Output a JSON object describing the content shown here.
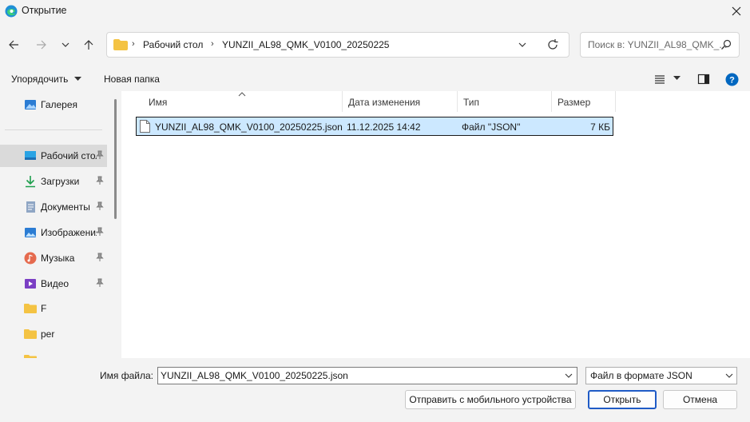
{
  "window": {
    "title": "Открытие",
    "close_glyph": "✕"
  },
  "address": {
    "segments": [
      "Рабочий стол",
      "YUNZII_AL98_QMK_V0100_20250225"
    ],
    "separator": "›"
  },
  "search": {
    "placeholder": "Поиск в: YUNZII_AL98_QMK_..."
  },
  "toolbar": {
    "organize_label": "Упорядочить",
    "new_folder_label": "Новая папка"
  },
  "sidebar": {
    "items": [
      {
        "label": "Галерея",
        "icon": "gallery-icon",
        "pinned": false
      },
      {
        "label": "Рабочий стол",
        "icon": "desktop-icon",
        "pinned": true,
        "selected": true
      },
      {
        "label": "Загрузки",
        "icon": "download-icon",
        "pinned": true
      },
      {
        "label": "Документы",
        "icon": "documents-icon",
        "pinned": true
      },
      {
        "label": "Изображения",
        "icon": "pictures-icon",
        "pinned": true
      },
      {
        "label": "Музыка",
        "icon": "music-icon",
        "pinned": true
      },
      {
        "label": "Видео",
        "icon": "video-icon",
        "pinned": true
      },
      {
        "label": "F",
        "icon": "folder-icon",
        "pinned": false
      },
      {
        "label": "per",
        "icon": "folder-icon",
        "pinned": false
      }
    ]
  },
  "columns": {
    "name": "Имя",
    "date": "Дата изменения",
    "type": "Тип",
    "size": "Размер"
  },
  "files": [
    {
      "name": "YUNZII_AL98_QMK_V0100_20250225.json",
      "date": "11.12.2025 14:42",
      "type": "Файл \"JSON\"",
      "size": "7 КБ"
    }
  ],
  "bottom": {
    "filename_label": "Имя файла:",
    "filename_value": "YUNZII_AL98_QMK_V0100_20250225.json",
    "filetype_value": "Файл в формате JSON",
    "send_mobile_label": "Отправить с мобильного устройства",
    "open_label": "Открыть",
    "cancel_label": "Отмена"
  },
  "colors": {
    "selection": "#cce8ff",
    "accent": "#0067c0",
    "folder": "#f4c343"
  }
}
